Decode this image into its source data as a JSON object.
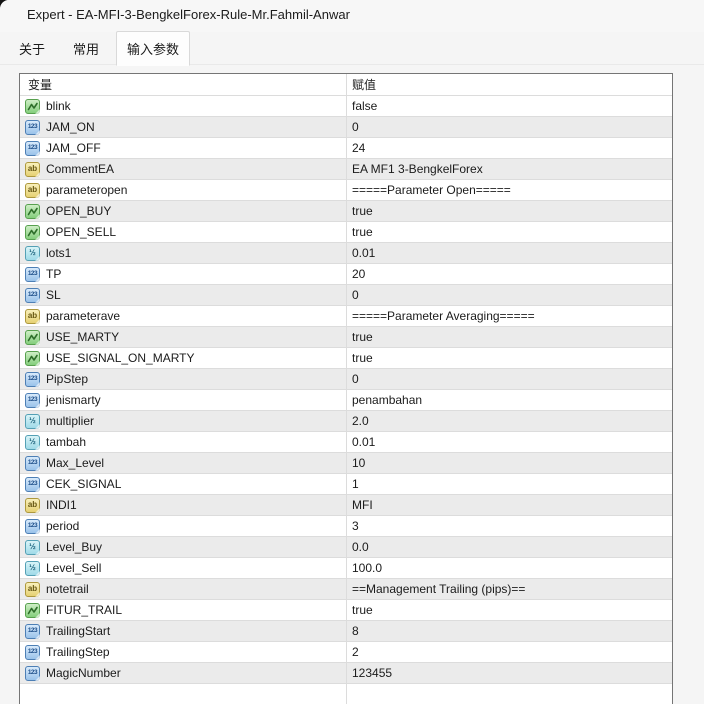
{
  "window": {
    "title": "Expert - EA-MFI-3-BengkelForex-Rule-Mr.Fahmil-Anwar"
  },
  "tabs": [
    {
      "label": "关于",
      "active": false
    },
    {
      "label": "常用",
      "active": false
    },
    {
      "label": "输入参数",
      "active": true
    }
  ],
  "table": {
    "columns": [
      {
        "label": "变量"
      },
      {
        "label": "赋值"
      }
    ],
    "rows": [
      {
        "name": "blink",
        "type": "bool",
        "value": "false"
      },
      {
        "name": "JAM_ON",
        "type": "int",
        "value": "0"
      },
      {
        "name": "JAM_OFF",
        "type": "int",
        "value": "24"
      },
      {
        "name": "CommentEA",
        "type": "string",
        "value": "EA MF1 3-BengkelForex"
      },
      {
        "name": "parameteropen",
        "type": "string",
        "value": "=====Parameter Open====="
      },
      {
        "name": "OPEN_BUY",
        "type": "bool",
        "value": "true"
      },
      {
        "name": "OPEN_SELL",
        "type": "bool",
        "value": "true"
      },
      {
        "name": "lots1",
        "type": "double",
        "value": "0.01"
      },
      {
        "name": "TP",
        "type": "int",
        "value": "20"
      },
      {
        "name": "SL",
        "type": "int",
        "value": "0"
      },
      {
        "name": "parameterave",
        "type": "string",
        "value": "=====Parameter Averaging====="
      },
      {
        "name": "USE_MARTY",
        "type": "bool",
        "value": "true"
      },
      {
        "name": "USE_SIGNAL_ON_MARTY",
        "type": "bool",
        "value": "true"
      },
      {
        "name": "PipStep",
        "type": "int",
        "value": "0"
      },
      {
        "name": "jenismarty",
        "type": "int",
        "value": "penambahan"
      },
      {
        "name": "multiplier",
        "type": "double",
        "value": "2.0"
      },
      {
        "name": "tambah",
        "type": "double",
        "value": "0.01"
      },
      {
        "name": "Max_Level",
        "type": "int",
        "value": "10"
      },
      {
        "name": "CEK_SIGNAL",
        "type": "int",
        "value": "1"
      },
      {
        "name": "INDI1",
        "type": "string",
        "value": "MFI"
      },
      {
        "name": "period",
        "type": "int",
        "value": "3"
      },
      {
        "name": "Level_Buy",
        "type": "double",
        "value": "0.0"
      },
      {
        "name": "Level_Sell",
        "type": "double",
        "value": "100.0"
      },
      {
        "name": "notetrail",
        "type": "string",
        "value": "==Management Trailing (pips)=="
      },
      {
        "name": "FITUR_TRAIL",
        "type": "bool",
        "value": "true"
      },
      {
        "name": "TrailingStart",
        "type": "int",
        "value": "8"
      },
      {
        "name": "TrailingStep",
        "type": "int",
        "value": "2"
      },
      {
        "name": "MagicNumber",
        "type": "int",
        "value": "123455"
      }
    ]
  },
  "type_icons": {
    "bool": {
      "glyph": "zigzag",
      "semantic": "boolean-type-icon",
      "border": "#57a04e"
    },
    "int": {
      "glyph": "123",
      "semantic": "integer-type-icon",
      "border": "#4d7fb5"
    },
    "double": {
      "glyph": "½",
      "semantic": "double-type-icon",
      "border": "#54a0b5"
    },
    "string": {
      "glyph": "ab",
      "semantic": "string-type-icon",
      "border": "#ad983d"
    }
  },
  "colors": {
    "dialog_bg": "#f5f5f5",
    "row_alt_bg": "#ebebeb",
    "grid_line": "#dcdcdc",
    "table_border": "#757575",
    "active_tab_bg": "#fdfdfd",
    "text": "#1b1b1b"
  }
}
